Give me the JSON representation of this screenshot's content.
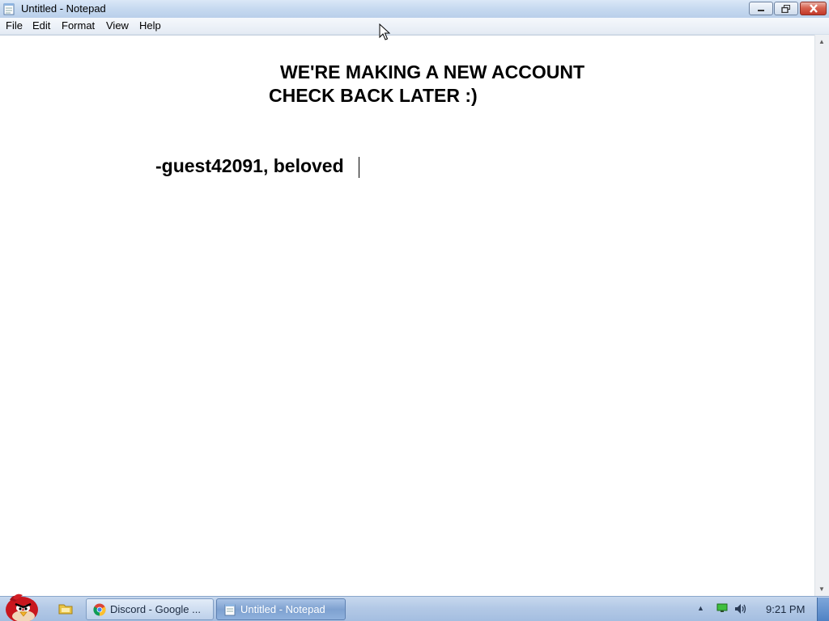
{
  "window": {
    "title": "Untitled - Notepad",
    "icon": "notepad-icon"
  },
  "menu": {
    "items": [
      "File",
      "Edit",
      "Format",
      "View",
      "Help"
    ]
  },
  "document": {
    "lines": [
      "WE'RE MAKING A NEW ACCOUNT",
      "CHECK BACK LATER :)",
      "-guest42091, beloved"
    ]
  },
  "taskbar": {
    "tasks": [
      {
        "label": "Discord - Google ...",
        "icon": "chrome-icon"
      },
      {
        "label": "Untitled - Notepad",
        "icon": "notepad-icon",
        "active": true
      }
    ],
    "clock": "9:21 PM"
  },
  "colors": {
    "titlebar": "#c6d9f0",
    "close_button": "#c2382a",
    "editor_bg": "#ffffff",
    "taskbar": "#b3c9e6"
  }
}
